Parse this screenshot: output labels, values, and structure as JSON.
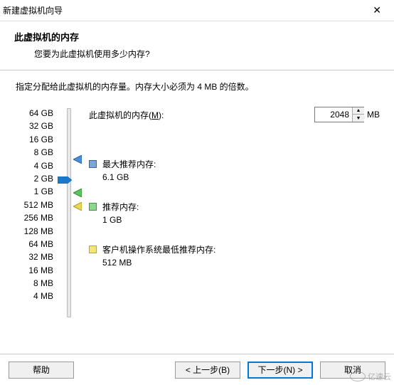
{
  "titlebar": {
    "title": "新建虚拟机向导"
  },
  "header": {
    "title": "此虚拟机的内存",
    "subtitle": "您要为此虚拟机使用多少内存?"
  },
  "instruction": "指定分配给此虚拟机的内存量。内存大小必须为 4 MB 的倍数。",
  "scale": [
    "64 GB",
    "32 GB",
    "16 GB",
    "8 GB",
    "4 GB",
    "2 GB",
    "1 GB",
    "512 MB",
    "256 MB",
    "128 MB",
    "64 MB",
    "32 MB",
    "16 MB",
    "8 MB",
    "4 MB"
  ],
  "slider": {
    "value_index": 5,
    "markers": {
      "max_index": 3.4,
      "rec_index": 6,
      "min_index": 7
    }
  },
  "memory": {
    "label_pre": "此虚拟机的内存(",
    "label_u": "M",
    "label_post": "):",
    "value": "2048",
    "unit": "MB"
  },
  "recs": {
    "max": {
      "label": "最大推荐内存:",
      "value": "6.1 GB"
    },
    "rec": {
      "label": "推荐内存:",
      "value": "1 GB"
    },
    "min": {
      "label": "客户机操作系统最低推荐内存:",
      "value": "512 MB"
    }
  },
  "buttons": {
    "help": "帮助",
    "back": "< 上一步(B)",
    "next": "下一步(N) >",
    "cancel": "取消"
  },
  "watermark": "亿速云"
}
